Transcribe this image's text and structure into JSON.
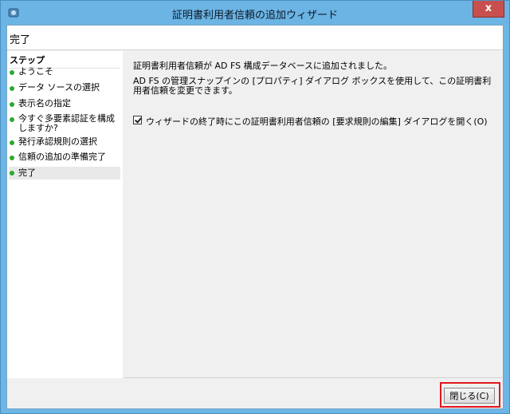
{
  "window": {
    "title": "証明書利用者信頼の追加ウィザード",
    "close_glyph": "x"
  },
  "header": {
    "title": "完了"
  },
  "steps": {
    "heading": "ステップ",
    "items": [
      {
        "label": "ようこそ"
      },
      {
        "label": "データ ソースの選択"
      },
      {
        "label": "表示名の指定"
      },
      {
        "label": "今すぐ多要素認証を構成しますか?"
      },
      {
        "label": "発行承認規則の選択"
      },
      {
        "label": "信頼の追加の準備完了"
      },
      {
        "label": "完了"
      }
    ],
    "current_index": 6,
    "dot_color": "#2fa82f"
  },
  "content": {
    "message1": "証明書利用者信頼が AD FS 構成データベースに追加されました。",
    "message2": "AD FS の管理スナップインの [プロパティ] ダイアログ ボックスを使用して、この証明書利用者信頼を変更できます。",
    "checkbox": {
      "label": "ウィザードの終了時にこの証明書利用者信頼の [要求規則の編集] ダイアログを開く(O)",
      "checked": true
    }
  },
  "footer": {
    "close_label": "閉じる(C)",
    "highlight_color": "#e3161c"
  }
}
